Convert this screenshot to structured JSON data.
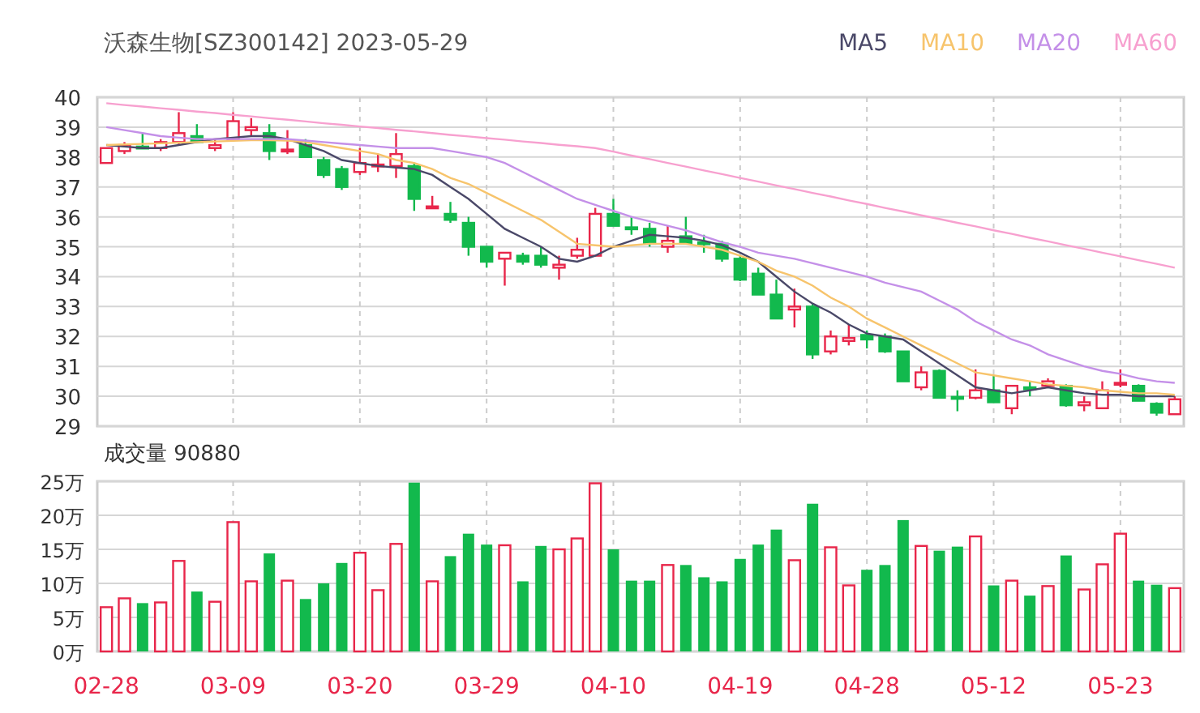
{
  "title": "沃森生物[SZ300142] 2023-05-29",
  "price_chart": {
    "chart_data": {
      "type": "candlestick",
      "grid": true,
      "ylim": [
        29,
        40
      ],
      "yticks": [
        29,
        30,
        31,
        32,
        33,
        34,
        35,
        36,
        37,
        38,
        39,
        40
      ],
      "series": [
        {
          "name": "MA5",
          "type": "line",
          "color": "#4a4868",
          "values": [
            38.4,
            38.35,
            38.3,
            38.3,
            38.4,
            38.5,
            38.6,
            38.65,
            38.7,
            38.7,
            38.6,
            38.4,
            38.2,
            37.9,
            37.8,
            37.7,
            37.65,
            37.6,
            37.4,
            37.0,
            36.6,
            36.1,
            35.6,
            35.3,
            35.0,
            34.6,
            34.5,
            34.7,
            35.0,
            35.2,
            35.4,
            35.35,
            35.3,
            35.2,
            35.05,
            34.8,
            34.5,
            34.0,
            33.5,
            33.1,
            32.8,
            32.4,
            32.1,
            32.0,
            31.9,
            31.5,
            31.1,
            30.7,
            30.3,
            30.2,
            30.1,
            30.2,
            30.3,
            30.2,
            30.1,
            30.05,
            30.05,
            30.0,
            30.0,
            30.0
          ]
        },
        {
          "name": "MA10",
          "type": "line",
          "color": "#f7c46c",
          "values": [
            38.4,
            38.42,
            38.44,
            38.46,
            38.48,
            38.5,
            38.52,
            38.54,
            38.56,
            38.56,
            38.55,
            38.5,
            38.4,
            38.3,
            38.2,
            38.1,
            37.9,
            37.8,
            37.6,
            37.3,
            37.1,
            36.8,
            36.5,
            36.2,
            35.9,
            35.5,
            35.1,
            35.05,
            35.0,
            35.05,
            35.1,
            35.1,
            35.1,
            35.0,
            34.9,
            34.7,
            34.5,
            34.2,
            34.0,
            33.7,
            33.3,
            33.0,
            32.6,
            32.3,
            32.0,
            31.7,
            31.4,
            31.1,
            30.8,
            30.7,
            30.6,
            30.5,
            30.4,
            30.35,
            30.3,
            30.2,
            30.15,
            30.1,
            30.1,
            30.05
          ]
        },
        {
          "name": "MA20",
          "type": "line",
          "color": "#c490e8",
          "values": [
            39.0,
            38.9,
            38.8,
            38.7,
            38.65,
            38.6,
            38.6,
            38.6,
            38.6,
            38.6,
            38.6,
            38.55,
            38.5,
            38.45,
            38.4,
            38.35,
            38.3,
            38.3,
            38.3,
            38.2,
            38.1,
            38.0,
            37.8,
            37.5,
            37.2,
            36.9,
            36.6,
            36.4,
            36.2,
            36.0,
            35.85,
            35.7,
            35.55,
            35.35,
            35.15,
            35.0,
            34.8,
            34.7,
            34.6,
            34.45,
            34.3,
            34.15,
            34.0,
            33.8,
            33.65,
            33.5,
            33.2,
            32.9,
            32.5,
            32.2,
            31.9,
            31.7,
            31.4,
            31.2,
            31.0,
            30.85,
            30.75,
            30.6,
            30.5,
            30.45
          ]
        },
        {
          "name": "MA60",
          "type": "line",
          "color": "#f7a0cf",
          "values": [
            39.8,
            39.74,
            39.69,
            39.63,
            39.58,
            39.52,
            39.47,
            39.41,
            39.36,
            39.3,
            39.25,
            39.19,
            39.13,
            39.08,
            39.02,
            38.97,
            38.91,
            38.86,
            38.8,
            38.74,
            38.69,
            38.63,
            38.58,
            38.52,
            38.47,
            38.41,
            38.36,
            38.3,
            38.18,
            38.05,
            37.93,
            37.8,
            37.68,
            37.55,
            37.43,
            37.3,
            37.18,
            37.05,
            36.93,
            36.8,
            36.68,
            36.55,
            36.43,
            36.3,
            36.18,
            36.05,
            35.93,
            35.8,
            35.68,
            35.55,
            35.43,
            35.3,
            35.18,
            35.05,
            34.93,
            34.8,
            34.68,
            34.55,
            34.43,
            34.3
          ]
        }
      ],
      "ohlc": [
        [
          37.8,
          38.3,
          37.8,
          38.3
        ],
        [
          38.2,
          38.5,
          38.1,
          38.4
        ],
        [
          38.35,
          38.8,
          38.3,
          38.3
        ],
        [
          38.3,
          38.6,
          38.2,
          38.5
        ],
        [
          38.5,
          39.5,
          38.4,
          38.8
        ],
        [
          38.7,
          39.1,
          38.5,
          38.5
        ],
        [
          38.3,
          38.6,
          38.2,
          38.4
        ],
        [
          38.6,
          39.5,
          38.6,
          39.2
        ],
        [
          38.9,
          39.3,
          38.7,
          39.0
        ],
        [
          38.8,
          39.1,
          37.9,
          38.2
        ],
        [
          38.2,
          38.9,
          38.1,
          38.25
        ],
        [
          38.4,
          38.6,
          38.0,
          38.0
        ],
        [
          37.9,
          38.0,
          37.3,
          37.4
        ],
        [
          37.6,
          37.7,
          36.9,
          37.0
        ],
        [
          37.5,
          38.3,
          37.4,
          37.8
        ],
        [
          37.7,
          38.1,
          37.5,
          37.75
        ],
        [
          37.7,
          38.8,
          37.3,
          38.1
        ],
        [
          37.7,
          37.8,
          36.2,
          36.6
        ],
        [
          36.3,
          36.7,
          36.3,
          36.35
        ],
        [
          36.1,
          36.5,
          35.8,
          35.9
        ],
        [
          35.8,
          36.0,
          34.7,
          35.0
        ],
        [
          35.0,
          35.0,
          34.3,
          34.5
        ],
        [
          34.6,
          34.8,
          33.7,
          34.8
        ],
        [
          34.7,
          34.8,
          34.4,
          34.5
        ],
        [
          34.7,
          35.0,
          34.3,
          34.4
        ],
        [
          34.3,
          34.7,
          33.9,
          34.4
        ],
        [
          34.7,
          35.3,
          34.6,
          34.9
        ],
        [
          34.7,
          36.3,
          34.7,
          36.1
        ],
        [
          36.1,
          36.6,
          35.7,
          35.7
        ],
        [
          35.65,
          36.0,
          35.4,
          35.6
        ],
        [
          35.6,
          35.8,
          35.0,
          35.1
        ],
        [
          35.0,
          35.7,
          34.8,
          35.2
        ],
        [
          35.35,
          36.0,
          35.1,
          35.1
        ],
        [
          35.15,
          35.4,
          34.8,
          35.1
        ],
        [
          35.1,
          35.2,
          34.5,
          34.6
        ],
        [
          34.6,
          34.7,
          33.85,
          33.9
        ],
        [
          34.1,
          34.3,
          33.4,
          33.4
        ],
        [
          33.4,
          33.9,
          32.6,
          32.6
        ],
        [
          32.9,
          33.6,
          32.3,
          33.0
        ],
        [
          33.0,
          33.1,
          31.25,
          31.4
        ],
        [
          31.5,
          32.2,
          31.4,
          32.0
        ],
        [
          31.85,
          32.4,
          31.7,
          31.95
        ],
        [
          32.05,
          32.2,
          31.6,
          31.9
        ],
        [
          32.0,
          32.1,
          31.45,
          31.5
        ],
        [
          31.5,
          31.5,
          30.5,
          30.5
        ],
        [
          30.3,
          31.0,
          30.2,
          30.8
        ],
        [
          30.85,
          30.9,
          29.95,
          29.95
        ],
        [
          29.98,
          30.2,
          29.5,
          29.95
        ],
        [
          29.95,
          30.9,
          29.9,
          30.2
        ],
        [
          30.2,
          30.7,
          29.8,
          29.8
        ],
        [
          29.6,
          30.35,
          29.4,
          30.35
        ],
        [
          30.3,
          30.5,
          30.0,
          30.25
        ],
        [
          30.35,
          30.6,
          30.3,
          30.5
        ],
        [
          30.35,
          30.4,
          29.65,
          29.7
        ],
        [
          29.7,
          30.0,
          29.5,
          29.8
        ],
        [
          29.6,
          30.5,
          29.6,
          30.2
        ],
        [
          30.4,
          30.9,
          30.3,
          30.45
        ],
        [
          30.35,
          30.4,
          29.85,
          29.85
        ],
        [
          29.75,
          29.8,
          29.35,
          29.45
        ],
        [
          29.4,
          30.0,
          29.4,
          29.9
        ]
      ]
    }
  },
  "volume_label": "成交量 90880",
  "volume_chart": {
    "chart_data": {
      "type": "bar",
      "grid": true,
      "categories": [
        "02-28",
        null,
        null,
        null,
        null,
        null,
        null,
        "03-09",
        null,
        null,
        null,
        null,
        null,
        null,
        "03-20",
        null,
        null,
        null,
        null,
        null,
        null,
        "03-29",
        null,
        null,
        null,
        null,
        null,
        null,
        "04-10",
        null,
        null,
        null,
        null,
        null,
        null,
        "04-19",
        null,
        null,
        null,
        null,
        null,
        null,
        "04-28",
        null,
        null,
        null,
        null,
        null,
        null,
        "05-12",
        null,
        null,
        null,
        null,
        null,
        null,
        "05-23",
        null,
        null,
        null
      ],
      "ylim": [
        0,
        25
      ],
      "yticks": [
        {
          "value": 0,
          "label": "0万"
        },
        {
          "value": 5,
          "label": "5万"
        },
        {
          "value": 10,
          "label": "10万"
        },
        {
          "value": 15,
          "label": "15万"
        },
        {
          "value": 20,
          "label": "20万"
        },
        {
          "value": 25,
          "label": "25万"
        }
      ],
      "values": [
        6.5,
        7.8,
        7.1,
        7.2,
        13.3,
        8.8,
        7.3,
        19,
        10.3,
        14.4,
        10.4,
        7.7,
        10,
        13,
        14.5,
        9,
        15.8,
        24.8,
        10.3,
        14,
        17.3,
        15.7,
        15.6,
        10.3,
        15.5,
        15,
        16.6,
        24.7,
        15,
        10.4,
        10.4,
        12.7,
        12.7,
        10.9,
        10.3,
        13.6,
        15.7,
        17.9,
        13.4,
        21.7,
        15.3,
        9.7,
        12,
        12.7,
        19.3,
        15.5,
        14.8,
        15.4,
        16.9,
        9.7,
        10.4,
        8.2,
        9.6,
        14.1,
        9.1,
        12.8,
        17.3,
        10.4,
        9.8,
        9.3
      ]
    }
  }
}
